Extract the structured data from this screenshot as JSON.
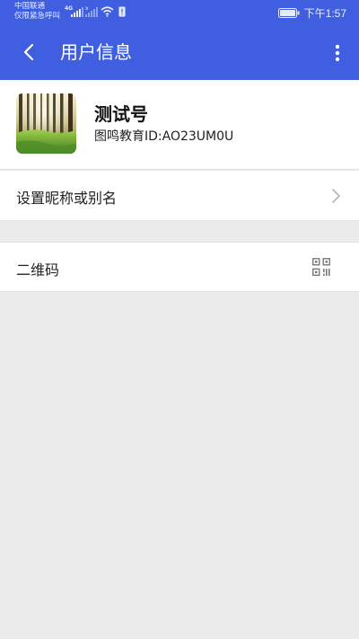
{
  "status_bar": {
    "carrier_line1": "中国联通",
    "carrier_line2": "仅限紧急呼叫",
    "network_type": "4G",
    "time": "下午1:57"
  },
  "nav": {
    "title": "用户信息",
    "back_icon": "chevron-left-icon",
    "more_icon": "more-vertical-icon"
  },
  "profile": {
    "nickname": "测试号",
    "account_id": "图鸣教育ID:AO23UM0U"
  },
  "menu": {
    "set_nickname_label": "设置昵称或别名",
    "qrcode_label": "二维码"
  },
  "colors": {
    "header": "#3f5fe0",
    "background": "#ececec",
    "row": "#ffffff"
  }
}
